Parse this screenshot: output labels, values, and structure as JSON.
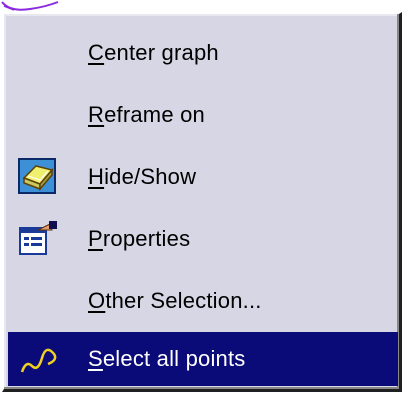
{
  "menu": {
    "items": [
      {
        "first": "C",
        "rest": "enter graph",
        "icon": null,
        "selected": false
      },
      {
        "first": "R",
        "rest": "eframe on",
        "icon": null,
        "selected": false
      },
      {
        "first": "H",
        "rest": "ide/Show",
        "icon": "hide-show-icon",
        "selected": false
      },
      {
        "first": "P",
        "rest": "roperties",
        "icon": "properties-icon",
        "selected": false
      },
      {
        "first": "O",
        "rest": "ther Selection...",
        "icon": null,
        "selected": false
      },
      {
        "first": "S",
        "rest": "elect all points",
        "icon": "select-points-icon",
        "selected": true
      }
    ],
    "colors": {
      "background": "#d6d6e4",
      "highlight": "#0a0a78",
      "highlight_text": "#ffffff"
    }
  }
}
